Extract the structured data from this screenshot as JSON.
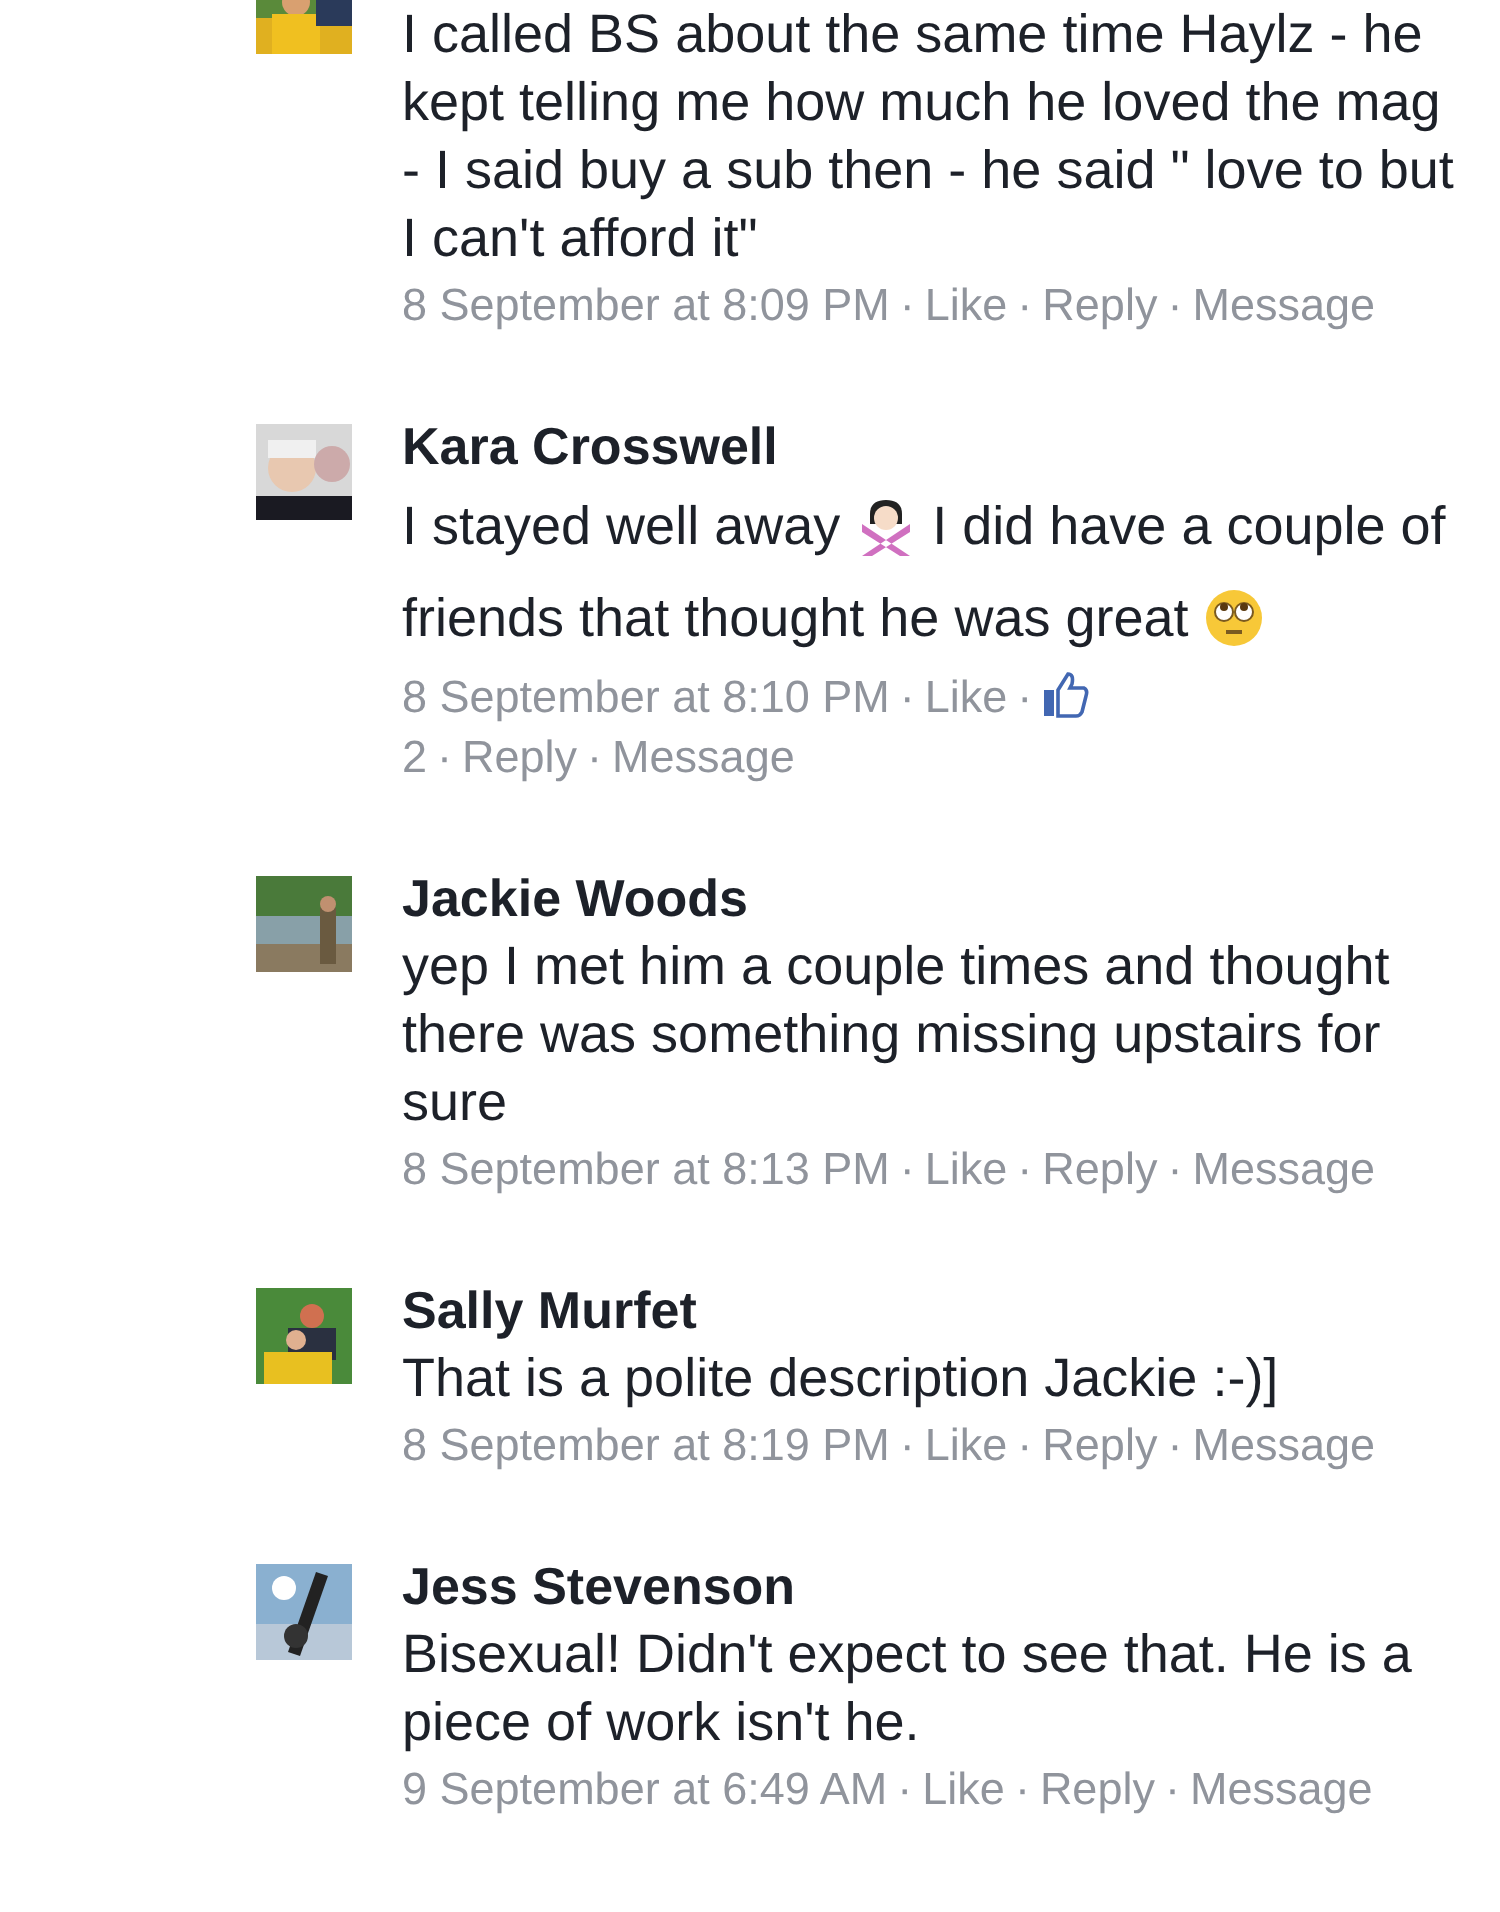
{
  "separator": "·",
  "comments": [
    {
      "body": [
        {
          "kind": "text",
          "text": "I called BS about the same time Haylz - he kept telling me how much he loved the mag - I said buy a sub then - he said \" love to but I can't afford it\""
        }
      ],
      "actions": [
        {
          "kind": "time",
          "text": "8 September at 8:09 PM"
        },
        {
          "kind": "link",
          "text": "Like"
        },
        {
          "kind": "link",
          "text": "Reply"
        },
        {
          "kind": "link",
          "text": "Message"
        }
      ]
    },
    {
      "name": "Kara Crosswell",
      "body": [
        {
          "kind": "text",
          "text": "I stayed well away"
        },
        {
          "kind": "gesture"
        },
        {
          "kind": "text",
          "text": "I did have a couple of friends that thought he was great"
        },
        {
          "kind": "eyeroll"
        }
      ],
      "actions": [
        {
          "kind": "time",
          "text": "8 September at 8:10 PM"
        },
        {
          "kind": "link",
          "text": "Like"
        },
        {
          "kind": "likes",
          "text": "2"
        },
        {
          "kind": "link",
          "text": "Reply"
        },
        {
          "kind": "link",
          "text": "Message"
        }
      ]
    },
    {
      "name": "Jackie Woods",
      "body": [
        {
          "kind": "text",
          "text": "yep I met him a couple times and thought there was something missing upstairs for sure"
        }
      ],
      "actions": [
        {
          "kind": "time",
          "text": "8 September at 8:13 PM"
        },
        {
          "kind": "link",
          "text": "Like"
        },
        {
          "kind": "link",
          "text": "Reply"
        },
        {
          "kind": "link",
          "text": "Message"
        }
      ]
    },
    {
      "name": "Sally Murfet",
      "body": [
        {
          "kind": "text",
          "text": "That is a polite description Jackie :-)]"
        }
      ],
      "actions": [
        {
          "kind": "time",
          "text": "8 September at 8:19 PM"
        },
        {
          "kind": "link",
          "text": "Like"
        },
        {
          "kind": "link",
          "text": "Reply"
        },
        {
          "kind": "link",
          "text": "Message"
        }
      ]
    },
    {
      "name": "Jess Stevenson",
      "body": [
        {
          "kind": "text",
          "text": "Bisexual! Didn't expect to see that. He is a piece of work isn't he."
        }
      ],
      "actions": [
        {
          "kind": "time",
          "text": "9 September at 6:49 AM"
        },
        {
          "kind": "link",
          "text": "Like"
        },
        {
          "kind": "link",
          "text": "Reply"
        },
        {
          "kind": "link",
          "text": "Message"
        }
      ]
    }
  ]
}
